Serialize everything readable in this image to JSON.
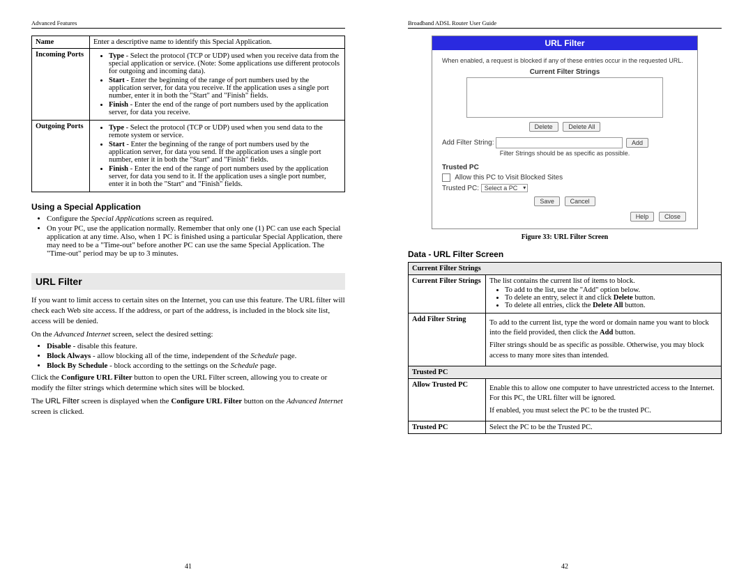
{
  "left": {
    "header": "Advanced Features",
    "pagenum": "41",
    "defs": {
      "name_label": "Name",
      "name_desc": "Enter a descriptive name to identify this Special Application.",
      "in_label": "Incoming Ports",
      "in_type": "Type - Select the protocol (TCP or UDP) used when you receive data from the special application or service. (Note: Some applications use different protocols for outgoing and incoming data).",
      "in_start": "Start - Enter the beginning of the range of port numbers used by the application server, for data you receive. If the application uses a single port number, enter it in both the \"Start\" and \"Finish\" fields.",
      "in_finish": "Finish - Enter the end of the range of port numbers used by the application server, for data you receive.",
      "out_label": "Outgoing Ports",
      "out_type": "Type - Select the protocol (TCP or UDP) used when you send data to the remote system or service.",
      "out_start": "Start - Enter the beginning of the range of port numbers used by the application server, for data you send. If the application uses a single port number, enter it in both the \"Start\" and \"Finish\" fields.",
      "out_finish": "Finish - Enter the end of the range of port numbers used by the application server, for data you send to it. If the application uses a single port number, enter it in both the \"Start\" and \"Finish\" fields."
    },
    "using_heading": "Using a Special Application",
    "using_b1": "Configure the Special Applications screen as required.",
    "using_b2": "On your PC, use the application normally. Remember that only one (1) PC can use each Special application at any time. Also, when 1 PC is finished using a particular Special Application, there may need to be a \"Time-out\" before another PC can use the same Special Application. The \"Time-out\" period may be up to 3 minutes.",
    "url_heading": "URL Filter",
    "url_p1": "If you want to limit access to certain sites on the Internet, you can use this feature. The URL filter will check each Web site access. If the address, or part of the address, is included in the block site list, access will be denied.",
    "url_p2_a": "On the ",
    "url_p2_i": "Advanced Internet",
    "url_p2_b": " screen, select the desired setting:",
    "url_b1_b": "Disable",
    "url_b1_t": " - disable this feature.",
    "url_b2_b": "Block Always",
    "url_b2_t": " - allow blocking all of the time, independent of the ",
    "url_b2_i": "Schedule",
    "url_b2_end": " page.",
    "url_b3_b": "Block By Schedule",
    "url_b3_t": " - block according to the settings on the ",
    "url_b3_i": "Schedule",
    "url_b3_end": " page.",
    "url_p3_a": "Click the ",
    "url_p3_b": "Configure URL Filter",
    "url_p3_c": " button to open the URL Filter screen, allowing you to create or modify the filter strings which determine which sites will be blocked.",
    "url_p4_a": "The ",
    "url_p4_sans": "URL Filter",
    "url_p4_b": " screen is displayed when the ",
    "url_p4_bold": "Configure URL Filter",
    "url_p4_c": " button on the ",
    "url_p4_i": "Advanced Internet",
    "url_p4_d": " screen is clicked."
  },
  "right": {
    "header": "Broadband ADSL Router User Guide",
    "pagenum": "42",
    "fig": {
      "title": "URL Filter",
      "note": "When enabled, a request is blocked if any of these entries occur in the requested URL.",
      "sub_current": "Current Filter Strings",
      "btn_delete": "Delete",
      "btn_delete_all": "Delete All",
      "add_label": "Add Filter String:",
      "btn_add": "Add",
      "filter_hint": "Filter Strings should be as specific as possible.",
      "trusted_head": "Trusted PC",
      "allow_cb": "Allow this PC to Visit Blocked Sites",
      "trusted_label": "Trusted PC:",
      "select_val": "Select a PC",
      "btn_save": "Save",
      "btn_cancel": "Cancel",
      "btn_help": "Help",
      "btn_close": "Close"
    },
    "fig_caption": "Figure 33: URL Filter Screen",
    "data_heading": "Data - URL Filter Screen",
    "tbl": {
      "sec1": "Current Filter Strings",
      "r1_label": "Current Filter Strings",
      "r1_desc": "The list contains the current list of items to block.",
      "r1_b1": "To add to the list, use the \"Add\" option below.",
      "r1_b2_a": "To delete an entry, select it and click ",
      "r1_b2_b": "Delete",
      "r1_b2_c": " button.",
      "r1_b3_a": "To delete all entries, click the ",
      "r1_b3_b": "Delete All",
      "r1_b3_c": " button.",
      "r2_label": "Add Filter String",
      "r2_p1_a": "To add to the current list, type the word or domain name you want to block into the field provided, then click the ",
      "r2_p1_b": "Add",
      "r2_p1_c": " button.",
      "r2_p2": "Filter strings should be as specific as possible. Otherwise, you may block access to many more sites than intended.",
      "sec2": "Trusted PC",
      "r3_label": "Allow Trusted PC",
      "r3_p1": "Enable this to allow one computer to have unrestricted access to the Internet. For this PC, the URL filter will be ignored.",
      "r3_p2": "If enabled, you must select the PC to be the trusted PC.",
      "r4_label": "Trusted PC",
      "r4_p": "Select the PC to be the Trusted PC."
    }
  }
}
